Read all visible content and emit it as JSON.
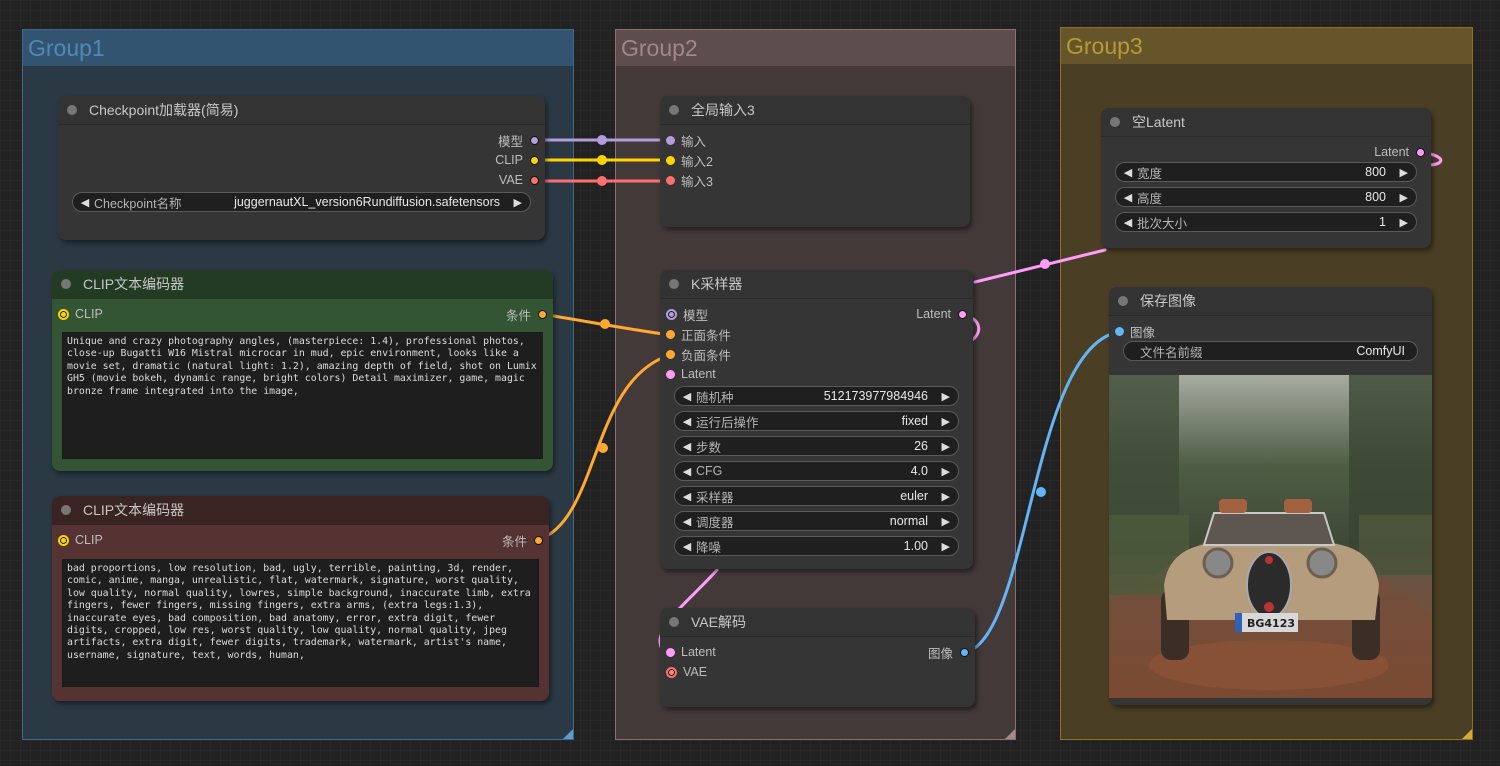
{
  "groups": [
    {
      "title": "Group1",
      "color": "#335470"
    },
    {
      "title": "Group2",
      "color": "#5d4d4d"
    },
    {
      "title": "Group3",
      "color": "#66552a"
    }
  ],
  "nodes": {
    "checkpoint_loader": {
      "title": "Checkpoint加载器(简易)",
      "outputs": [
        "模型",
        "CLIP",
        "VAE"
      ],
      "widget": {
        "label": "Checkpoint名称",
        "value": "juggernautXL_version6Rundiffusion.safetensors"
      }
    },
    "clip_positive": {
      "title": "CLIP文本编码器",
      "input": "CLIP",
      "output": "条件",
      "text": "Unique and crazy photography angles, (masterpiece: 1.4), professional photos, close-up Bugatti W16 Mistral microcar in mud, epic environment, looks like a movie set, dramatic (natural light: 1.2), amazing depth of field, shot on Lumix GH5 (movie bokeh, dynamic range, bright colors) Detail maximizer, game, magic bronze frame integrated into the image,"
    },
    "clip_negative": {
      "title": "CLIP文本编码器",
      "input": "CLIP",
      "output": "条件",
      "text": "bad proportions, low resolution, bad, ugly, terrible, painting, 3d, render, comic, anime, manga, unrealistic, flat, watermark, signature, worst quality, low quality, normal quality, lowres, simple background, inaccurate limb, extra fingers, fewer fingers, missing fingers, extra arms, (extra legs:1.3), inaccurate eyes, bad composition, bad anatomy, error, extra digit, fewer digits, cropped, low res, worst quality, low quality, normal quality, jpeg artifacts, extra digit, fewer digits, trademark, watermark, artist's name, username, signature, text, words, human,"
    },
    "global_input": {
      "title": "全局输入3",
      "inputs": [
        "输入",
        "输入2",
        "输入3"
      ]
    },
    "ksampler": {
      "title": "K采样器",
      "inputs": [
        "模型",
        "正面条件",
        "负面条件",
        "Latent"
      ],
      "output": "Latent",
      "widgets": [
        {
          "label": "随机种",
          "value": "512173977984946"
        },
        {
          "label": "运行后操作",
          "value": "fixed"
        },
        {
          "label": "步数",
          "value": "26"
        },
        {
          "label": "CFG",
          "value": "4.0"
        },
        {
          "label": "采样器",
          "value": "euler"
        },
        {
          "label": "调度器",
          "value": "normal"
        },
        {
          "label": "降噪",
          "value": "1.00"
        }
      ]
    },
    "vae_decode": {
      "title": "VAE解码",
      "inputs": [
        "Latent",
        "VAE"
      ],
      "output": "图像"
    },
    "empty_latent": {
      "title": "空Latent",
      "output": "Latent",
      "widgets": [
        {
          "label": "宽度",
          "value": "800"
        },
        {
          "label": "高度",
          "value": "800"
        },
        {
          "label": "批次大小",
          "value": "1"
        }
      ]
    },
    "save_image": {
      "title": "保存图像",
      "input": "图像",
      "widget": {
        "label": "文件名前缀",
        "value": "ComfyUI"
      },
      "preview": {
        "alt": "Muddy vintage Bugatti roadster on forest dirt road",
        "plate": "BG4123"
      }
    }
  },
  "wire_colors": {
    "model": "#b39ddb",
    "clip": "#ffd500",
    "vae": "#ff6e6e",
    "conditioning": "#ffa931",
    "latent": "#ff9cf9",
    "image": "#64b5f6"
  },
  "arrows": {
    "left": "◀",
    "right": "▶"
  }
}
